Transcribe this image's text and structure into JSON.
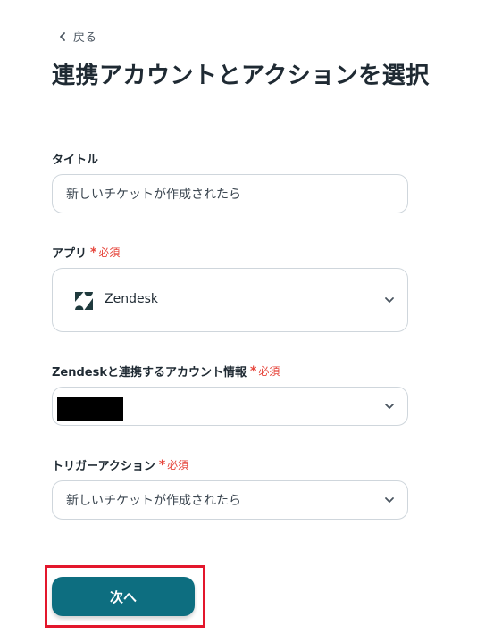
{
  "nav": {
    "back_label": "戻る"
  },
  "page": {
    "title": "連携アカウントとアクションを選択"
  },
  "required_text": "必須",
  "fields": {
    "title": {
      "label": "タイトル",
      "value": "新しいチケットが作成されたら"
    },
    "app": {
      "label": "アプリ",
      "value": "Zendesk"
    },
    "account": {
      "label": "Zendeskと連携するアカウント情報",
      "value_redacted": true
    },
    "trigger": {
      "label": "トリガーアクション",
      "value": "新しいチケットが作成されたら"
    }
  },
  "actions": {
    "next_label": "次へ"
  },
  "colors": {
    "primary": "#0d6e80",
    "required": "#e6463c",
    "highlight": "#e3172c",
    "border": "#cfd6dc"
  }
}
